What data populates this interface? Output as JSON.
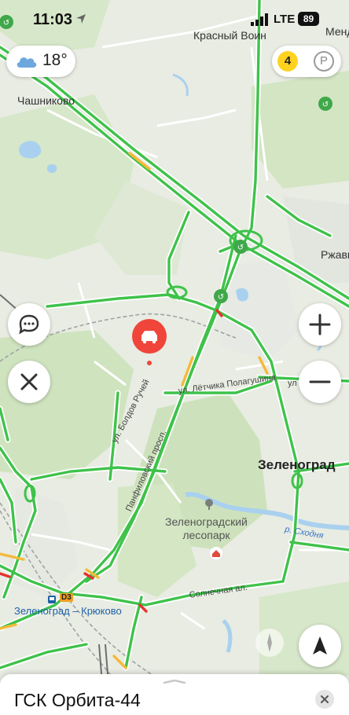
{
  "status_bar": {
    "time": "11:03",
    "network": "LTE",
    "battery": "89"
  },
  "weather": {
    "temperature": "18°",
    "icon": "cloud-icon"
  },
  "traffic": {
    "level": "4",
    "parking_label": "P"
  },
  "map": {
    "towns": [
      "Красный Воин",
      "Менд",
      "Чашниково",
      "Ржавк"
    ],
    "city": "Зеленоград",
    "park": [
      "Зеленоградский",
      "лесопарк"
    ],
    "streets": [
      "ул. Болдов Ручей",
      "ул. Лётчика Полагушина",
      "Панфиловский просп.",
      "Солнечная ал.",
      "ул"
    ],
    "station": {
      "badge": "D3",
      "label": "Зеленоград – Крюково"
    },
    "river": "р. Сходня"
  },
  "controls": {
    "zoom_in": "+",
    "zoom_out": "−"
  },
  "place": {
    "title": "ГСК Орбита-44"
  }
}
